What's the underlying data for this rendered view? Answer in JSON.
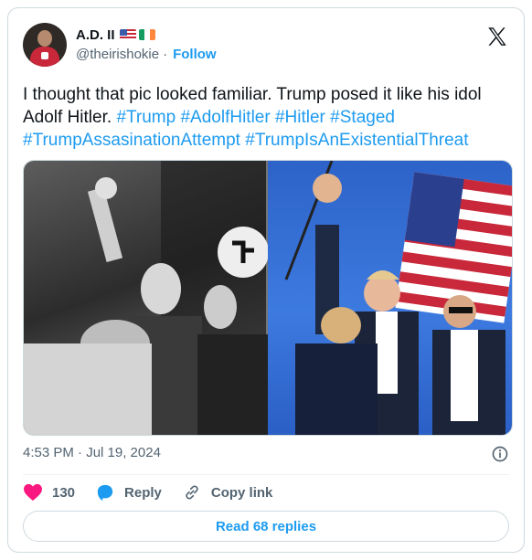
{
  "author": {
    "name": "A.D. II",
    "handle": "@theirishokie",
    "separator": "·",
    "follow_label": "Follow",
    "flags": [
      "us-flag",
      "ireland-flag"
    ]
  },
  "tweet": {
    "text_parts": [
      {
        "text": "I thought that pic looked familiar. Trump posed it like his idol Adolf Hitler. ",
        "type": "text"
      },
      {
        "text": "#Trump",
        "type": "hashtag"
      },
      {
        "text": " ",
        "type": "text"
      },
      {
        "text": "#AdolfHitler",
        "type": "hashtag"
      },
      {
        "text": " ",
        "type": "text"
      },
      {
        "text": "#Hitler",
        "type": "hashtag"
      },
      {
        "text": " ",
        "type": "text"
      },
      {
        "text": "#Staged",
        "type": "hashtag"
      },
      {
        "text": " ",
        "type": "text"
      },
      {
        "text": "#TrumpAssasinationAttempt",
        "type": "hashtag"
      },
      {
        "text": " ",
        "type": "text"
      },
      {
        "text": "#TrumpIsAnExistentialThreat",
        "type": "hashtag"
      }
    ],
    "timestamp": "4:53 PM · Jul 19, 2024"
  },
  "actions": {
    "like_count": "130",
    "reply_label": "Reply",
    "copy_label": "Copy link"
  },
  "read_replies_label": "Read 68 replies",
  "colors": {
    "accent": "#1d9bf0",
    "like": "#f91880",
    "muted": "#536471"
  }
}
